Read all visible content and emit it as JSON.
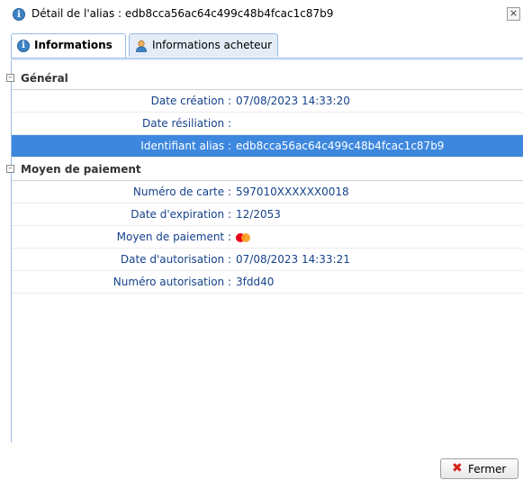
{
  "window": {
    "title": "Détail de l'alias : edb8cca56ac64c499c48b4fcac1c87b9",
    "close_label": "×"
  },
  "tabs": [
    {
      "label": "Informations",
      "icon": "info-icon",
      "active": true
    },
    {
      "label": "Informations acheteur",
      "icon": "user-icon",
      "active": false
    }
  ],
  "sections": {
    "general": {
      "title": "Général",
      "rows": [
        {
          "label": "Date création :",
          "value": "07/08/2023 14:33:20"
        },
        {
          "label": "Date résiliation :",
          "value": ""
        },
        {
          "label": "Identifiant alias :",
          "value": "edb8cca56ac64c499c48b4fcac1c87b9",
          "selected": true
        }
      ]
    },
    "payment": {
      "title": "Moyen de paiement",
      "rows": [
        {
          "label": "Numéro de carte :",
          "value": "597010XXXXXX0018"
        },
        {
          "label": "Date d'expiration :",
          "value": "12/2053"
        },
        {
          "label": "Moyen de paiement :",
          "value": "",
          "icon": "mastercard-icon"
        },
        {
          "label": "Date d'autorisation :",
          "value": "07/08/2023 14:33:21"
        },
        {
          "label": "Numéro autorisation :",
          "value": "3fdd40"
        }
      ]
    }
  },
  "footer": {
    "close_button_label": "Fermer"
  },
  "colors": {
    "selected_row": "#3d88de",
    "label_text": "#15428b",
    "tab_border": "#99bbe8"
  }
}
